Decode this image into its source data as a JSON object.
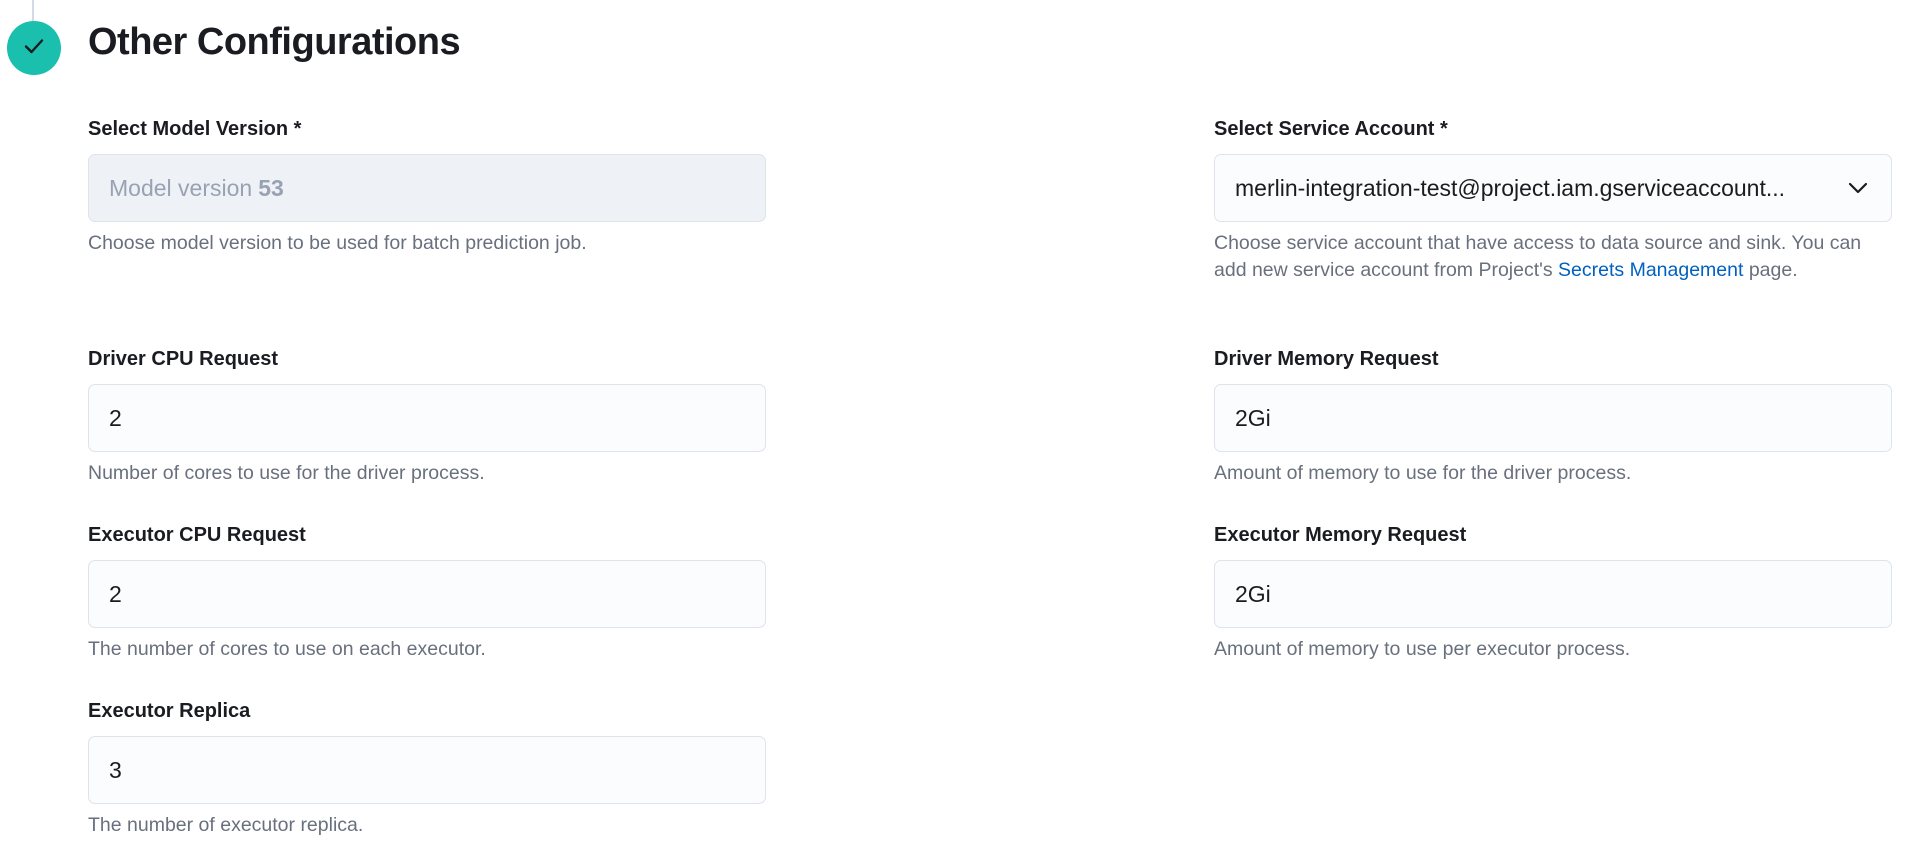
{
  "section": {
    "title": "Other Configurations",
    "status_icon": "check-icon",
    "accent_color": "#1bbfae"
  },
  "model_version": {
    "label": "Select Model Version *",
    "prefix": "Model version",
    "value": "53",
    "help": "Choose model version to be used for batch prediction job."
  },
  "service_account": {
    "label": "Select Service Account *",
    "value": "merlin-integration-test@project.iam.gserviceaccount...",
    "help_before": "Choose service account that have access to data source and sink. You can add new service account from Project's ",
    "help_link": "Secrets Management",
    "help_after": " page.",
    "link_color": "#0061c2"
  },
  "driver_cpu": {
    "label": "Driver CPU Request",
    "value": "2",
    "help": "Number of cores to use for the driver process."
  },
  "driver_memory": {
    "label": "Driver Memory Request",
    "value": "2Gi",
    "help": "Amount of memory to use for the driver process."
  },
  "executor_cpu": {
    "label": "Executor CPU Request",
    "value": "2",
    "help": "The number of cores to use on each executor."
  },
  "executor_memory": {
    "label": "Executor Memory Request",
    "value": "2Gi",
    "help": "Amount of memory to use per executor process."
  },
  "executor_replica": {
    "label": "Executor Replica",
    "value": "3",
    "help": "The number of executor replica."
  }
}
